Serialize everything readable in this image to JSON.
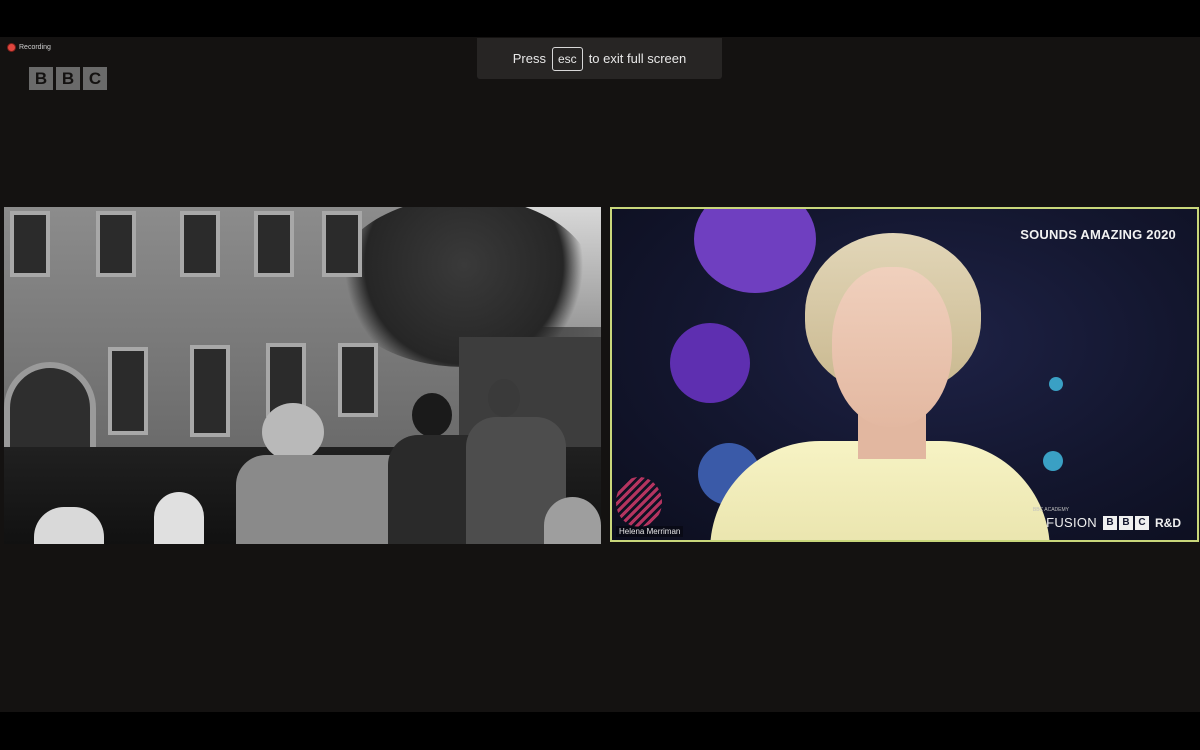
{
  "recording": {
    "label": "Recording"
  },
  "logo": {
    "letters": [
      "B",
      "B",
      "C"
    ]
  },
  "fullscreen_toast": {
    "prefix": "Press",
    "key": "esc",
    "suffix": "to exit full screen"
  },
  "shared_video": {
    "description_icon": "archive-photo"
  },
  "speaker": {
    "name": "Helena Merriman",
    "event_title": "SOUNDS AMAZING 2020",
    "branding": {
      "academy": "BBC ACADEMY",
      "fusion": "FUSION",
      "bbc_letters": [
        "B",
        "B",
        "C"
      ],
      "rd": "R&D"
    }
  },
  "colors": {
    "active_speaker_border": "#c9d77b",
    "purple_dot": "#6f3fc0",
    "teal_dot": "#3aa0c4",
    "blue_dot": "#3a5aa8",
    "recording_dot": "#e0463e"
  }
}
